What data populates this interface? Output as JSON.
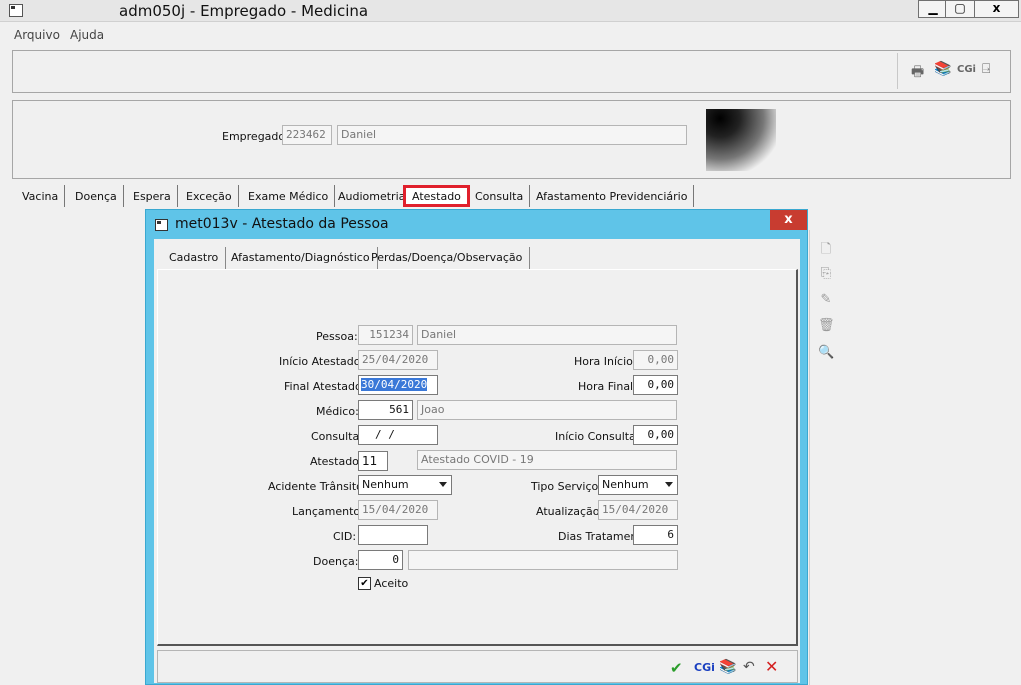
{
  "window": {
    "title": "adm050j - Empregado - Medicina",
    "minimize": "▁",
    "restore": "▢",
    "close": "x"
  },
  "menu": {
    "items": [
      "Arquivo",
      "Ajuda"
    ]
  },
  "toolbar": {
    "icons": [
      "printer-icon",
      "books-icon",
      "cgi-icon",
      "exit-door-icon"
    ],
    "cgi_label": "CGi"
  },
  "employee": {
    "label": "Empregado:",
    "code": "223462",
    "name": "Daniel"
  },
  "outer_tabs": [
    {
      "label": "Vacina"
    },
    {
      "label": "Doença"
    },
    {
      "label": "Espera"
    },
    {
      "label": "Exceção"
    },
    {
      "label": "Exame Médico"
    },
    {
      "label": "Audiometria"
    },
    {
      "label": "Atestado",
      "active": true
    },
    {
      "label": "Consulta"
    },
    {
      "label": "Afastamento Previdenciário"
    }
  ],
  "dialog": {
    "title": "met013v - Atestado da Pessoa",
    "close": "x",
    "tabs": [
      {
        "label": "Cadastro",
        "active": true
      },
      {
        "label": "Afastamento/Diagnóstico"
      },
      {
        "label": "Perdas/Doença/Observação"
      }
    ],
    "form": {
      "pessoa": {
        "label": "Pessoa:",
        "code": "151234",
        "name": "Daniel"
      },
      "inicio_atestado": {
        "label": "Início Atestado:",
        "value": "25/04/2020"
      },
      "hora_inicio": {
        "label": "Hora Início:",
        "value": "0,00"
      },
      "final_atestado": {
        "label": "Final Atestado:",
        "value": "30/04/2020"
      },
      "hora_final": {
        "label": "Hora Final:",
        "value": "0,00"
      },
      "medico": {
        "label": "Médico:",
        "code": "561",
        "name": "Joao"
      },
      "consulta": {
        "label": "Consulta:",
        "value": "/   /"
      },
      "inicio_consulta": {
        "label": "Início Consulta:",
        "value": "0,00"
      },
      "atestado": {
        "label": "Atestado:",
        "code": "11",
        "description": "Atestado COVID - 19"
      },
      "acidente_transito": {
        "label": "Acidente Trânsito:",
        "value": "Nenhum"
      },
      "tipo_servico": {
        "label": "Tipo Serviço:",
        "value": "Nenhum"
      },
      "lancamento": {
        "label": "Lançamento:",
        "value": "15/04/2020"
      },
      "atualizacao": {
        "label": "Atualização:",
        "value": "15/04/2020"
      },
      "cid": {
        "label": "CID:",
        "value": ""
      },
      "dias_tratamento": {
        "label": "Dias Tratamento:",
        "value": "6"
      },
      "doenca": {
        "label": "Doença:",
        "code": "0",
        "description": ""
      },
      "aceito": {
        "label": "Aceito",
        "checked": true
      }
    },
    "buttons": {
      "cgi_label": "CGi"
    }
  },
  "colors": {
    "dialog_frame": "#5fc4e8",
    "active_tab_outline": "#e0202c",
    "close_button": "#c83c30",
    "confirm_green": "#2a9d2a",
    "cancel_red": "#d42020",
    "cgi_blue": "#1a3fc0"
  }
}
